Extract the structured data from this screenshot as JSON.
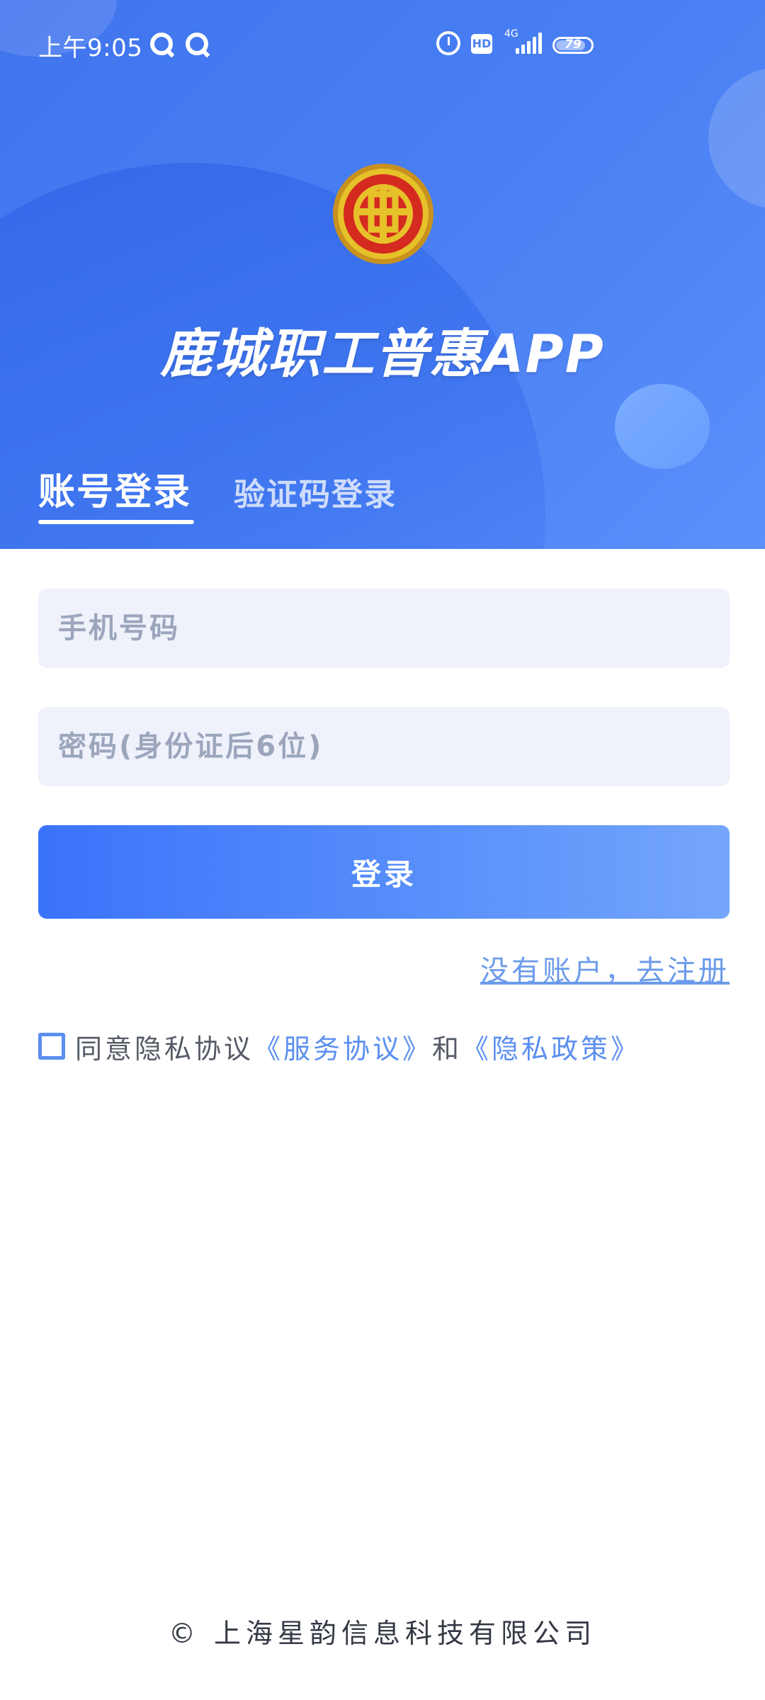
{
  "status_bar": {
    "time": "上午9:05",
    "hd": "HD",
    "network": "4G",
    "battery": "79"
  },
  "header": {
    "app_title": "鹿城职工普惠APP",
    "logo_icon": "union-emblem-icon"
  },
  "tabs": [
    {
      "label": "账号登录",
      "active": true
    },
    {
      "label": "验证码登录",
      "active": false
    }
  ],
  "form": {
    "phone_placeholder": "手机号码",
    "phone_value": "",
    "password_placeholder": "密码(身份证后6位)",
    "password_value": "",
    "login_label": "登录",
    "register_link": "没有账户，去注册"
  },
  "agreement": {
    "checked": false,
    "prefix": "同意隐私协议",
    "service_link": "《服务协议》",
    "and": "和",
    "privacy_link": "《隐私政策》"
  },
  "footer": {
    "copyright": "© 上海星韵信息科技有限公司"
  },
  "colors": {
    "primary": "#4a80f3",
    "link": "#5b8ff0",
    "field_bg": "#eff1fb"
  }
}
